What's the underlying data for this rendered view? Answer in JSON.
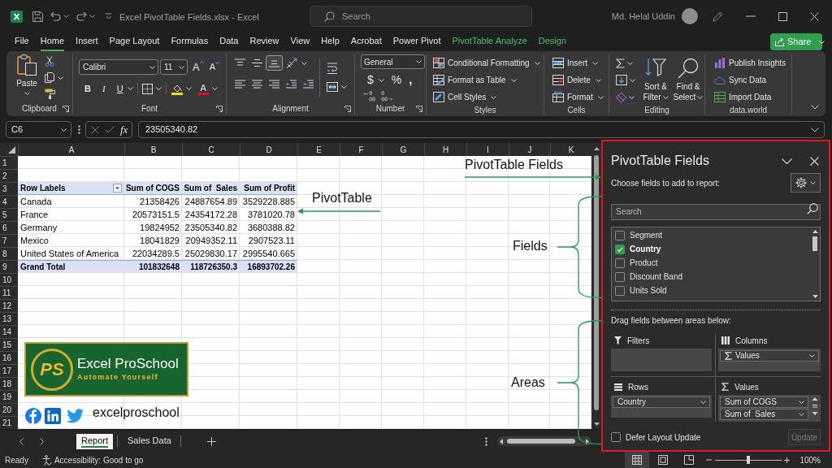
{
  "window": {
    "title": "Excel PivotTable Fields.xlsx - Excel",
    "search_placeholder": "Search",
    "user_name": "Md. Helal Uddin"
  },
  "ribbon_tabs": [
    {
      "label": "File",
      "kind": "standard",
      "selected": false
    },
    {
      "label": "Home",
      "kind": "standard",
      "selected": true
    },
    {
      "label": "Insert",
      "kind": "standard",
      "selected": false
    },
    {
      "label": "Page Layout",
      "kind": "standard",
      "selected": false
    },
    {
      "label": "Formulas",
      "kind": "standard",
      "selected": false
    },
    {
      "label": "Data",
      "kind": "standard",
      "selected": false
    },
    {
      "label": "Review",
      "kind": "standard",
      "selected": false
    },
    {
      "label": "View",
      "kind": "standard",
      "selected": false
    },
    {
      "label": "Help",
      "kind": "standard",
      "selected": false
    },
    {
      "label": "Acrobat",
      "kind": "standard",
      "selected": false
    },
    {
      "label": "Power Pivot",
      "kind": "standard",
      "selected": false
    },
    {
      "label": "PivotTable Analyze",
      "kind": "contextual",
      "selected": false
    },
    {
      "label": "Design",
      "kind": "contextual",
      "selected": false
    }
  ],
  "share_button": {
    "label": "Share"
  },
  "ribbon": {
    "clipboard": {
      "label": "Clipboard",
      "paste": "Paste"
    },
    "font": {
      "label": "Font",
      "font_name": "Calibri",
      "font_size": "11",
      "grow": "A",
      "shrink": "A",
      "bold": "B",
      "italic": "I",
      "underline": "U",
      "font_color": "A"
    },
    "alignment": {
      "label": "Alignment",
      "vertical": [
        {
          "kind": "top",
          "selected": false
        },
        {
          "kind": "middle",
          "selected": false
        },
        {
          "kind": "bottom",
          "selected": true
        }
      ]
    },
    "number": {
      "label": "Number",
      "format": "General",
      "currency": "$",
      "percent": "%",
      "comma": ","
    },
    "styles": {
      "label": "Styles",
      "commands": [
        {
          "label": "Conditional Formatting",
          "kind": "conditional"
        },
        {
          "label": "Format as Table",
          "kind": "table"
        },
        {
          "label": "Cell Styles",
          "kind": "cell_styles"
        }
      ]
    },
    "cells": {
      "label": "Cells",
      "commands": [
        {
          "label": "Insert",
          "kind": "insert"
        },
        {
          "label": "Delete",
          "kind": "delete"
        },
        {
          "label": "Format",
          "kind": "format"
        }
      ]
    },
    "editing": {
      "label": "Editing",
      "sort_filter": "Sort & Filter",
      "find_select": "Find & Select"
    },
    "data_world": {
      "label": "data.world",
      "commands": [
        {
          "label": "Publish Insights",
          "kind": "publish"
        },
        {
          "label": "Sync Data",
          "kind": "sync"
        },
        {
          "label": "Import Data",
          "kind": "import"
        }
      ]
    }
  },
  "formula_bar": {
    "name_box": "C6",
    "function_label": "fx",
    "value": "23505340.82"
  },
  "sheet": {
    "columns": [
      "A",
      "B",
      "C",
      "D",
      "E",
      "F",
      "G",
      "H",
      "I",
      "J",
      "K"
    ],
    "rows": [
      "1",
      "2",
      "3",
      "4",
      "5",
      "6",
      "7",
      "8",
      "9",
      "10",
      "11",
      "12",
      "13",
      "14",
      "15",
      "16",
      "17",
      "18",
      "19",
      "20",
      "21"
    ]
  },
  "pivot_table": {
    "header": [
      "Row Labels",
      "Sum of COGS",
      "Sum of  Sales",
      "Sum of Profit"
    ],
    "rows": [
      [
        "Canada",
        "21358426",
        "24887654.89",
        "3529228.885"
      ],
      [
        "France",
        "20573151.5",
        "24354172.28",
        "3781020.78"
      ],
      [
        "Germany",
        "19824952",
        "23505340.82",
        "3680388.82"
      ],
      [
        "Mexico",
        "18041829",
        "20949352.11",
        "2907523.11"
      ],
      [
        "United States of America",
        "22034289.5",
        "25029830.17",
        "2995540.665"
      ]
    ],
    "total": [
      "Grand Total",
      "101832648",
      "118726350.3",
      "16893702.26"
    ]
  },
  "annotations": [
    {
      "text": "PivotTable Fields",
      "kind": "arrow"
    },
    {
      "text": "PivotTable",
      "kind": "arrow"
    },
    {
      "text": "Fields",
      "kind": "brace"
    },
    {
      "text": "Areas",
      "kind": "brace"
    }
  ],
  "logo": {
    "monogram": "PS",
    "title": "Excel ProSchool",
    "tagline": "Automate Yourself"
  },
  "social": {
    "handle": "excelproschool"
  },
  "sheet_tabs": [
    {
      "label": "Report",
      "selected": true
    },
    {
      "label": "Sales Data",
      "selected": false
    }
  ],
  "pivot_fields": {
    "title": "PivotTable Fields",
    "prompt": "Choose fields to add to report:",
    "search_placeholder": "Search",
    "fields": [
      {
        "label": "Segment",
        "checked": false
      },
      {
        "label": "Country",
        "checked": true
      },
      {
        "label": "Product",
        "checked": false
      },
      {
        "label": "Discount Band",
        "checked": false
      },
      {
        "label": "Units Sold",
        "checked": false
      }
    ],
    "areas_prompt": "Drag fields between areas below:",
    "areas": [
      {
        "kind": "filters",
        "label": "Filters"
      },
      {
        "kind": "columns",
        "label": "Columns",
        "items": [
          {
            "label": "Values",
            "kind": "values"
          }
        ]
      },
      {
        "kind": "rows",
        "label": "Rows",
        "items": [
          {
            "label": "Country",
            "kind": "field"
          }
        ]
      },
      {
        "kind": "values",
        "label": "Values",
        "items": [
          {
            "label": "Sum of COGS",
            "kind": "field"
          },
          {
            "label": "Sum of  Sales",
            "kind": "field"
          }
        ]
      }
    ],
    "defer_update": {
      "label": "Defer Layout Update",
      "checked": false
    },
    "update_button": {
      "label": "Update",
      "disabled": true
    }
  },
  "status_bar": {
    "status": "Ready",
    "accessibility": "Accessibility: Good to go",
    "views": [
      {
        "kind": "normal",
        "selected": true
      },
      {
        "kind": "page_layout",
        "selected": false
      },
      {
        "kind": "page_break",
        "selected": false
      }
    ],
    "zoom": {
      "level": 0.5,
      "reading": "100%"
    }
  }
}
